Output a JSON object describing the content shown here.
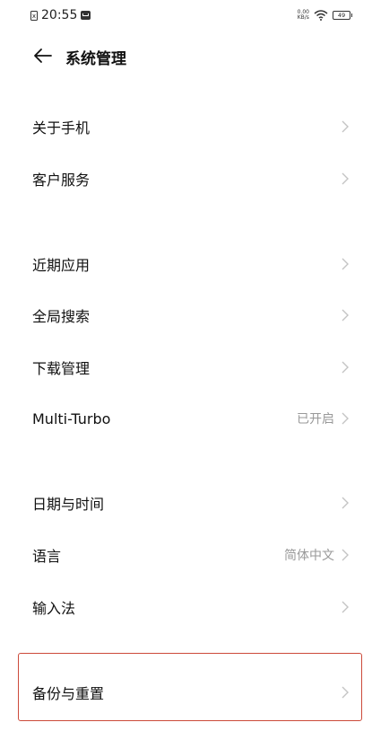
{
  "status_bar": {
    "sim_label": "x",
    "time": "20:55",
    "net_speed_value": "0.00",
    "net_speed_unit": "KB/s",
    "battery_level": "49"
  },
  "header": {
    "title": "系统管理"
  },
  "items": [
    {
      "label": "关于手机",
      "value": ""
    },
    {
      "label": "客户服务",
      "value": ""
    },
    {
      "label": "近期应用",
      "value": ""
    },
    {
      "label": "全局搜索",
      "value": ""
    },
    {
      "label": "下载管理",
      "value": ""
    },
    {
      "label": "Multi-Turbo",
      "value": "已开启"
    },
    {
      "label": "日期与时间",
      "value": ""
    },
    {
      "label": "语言",
      "value": "简体中文"
    },
    {
      "label": "输入法",
      "value": ""
    },
    {
      "label": "备份与重置",
      "value": ""
    }
  ],
  "colors": {
    "highlight": "#cc4a3a",
    "secondary_text": "#999999",
    "chevron": "#c4c4c4"
  },
  "icons": {
    "back": "arrow-left-icon",
    "row_chevron": "chevron-right-icon",
    "wifi": "wifi-icon",
    "battery": "battery-icon",
    "sim": "sim-icon",
    "message": "message-icon"
  }
}
